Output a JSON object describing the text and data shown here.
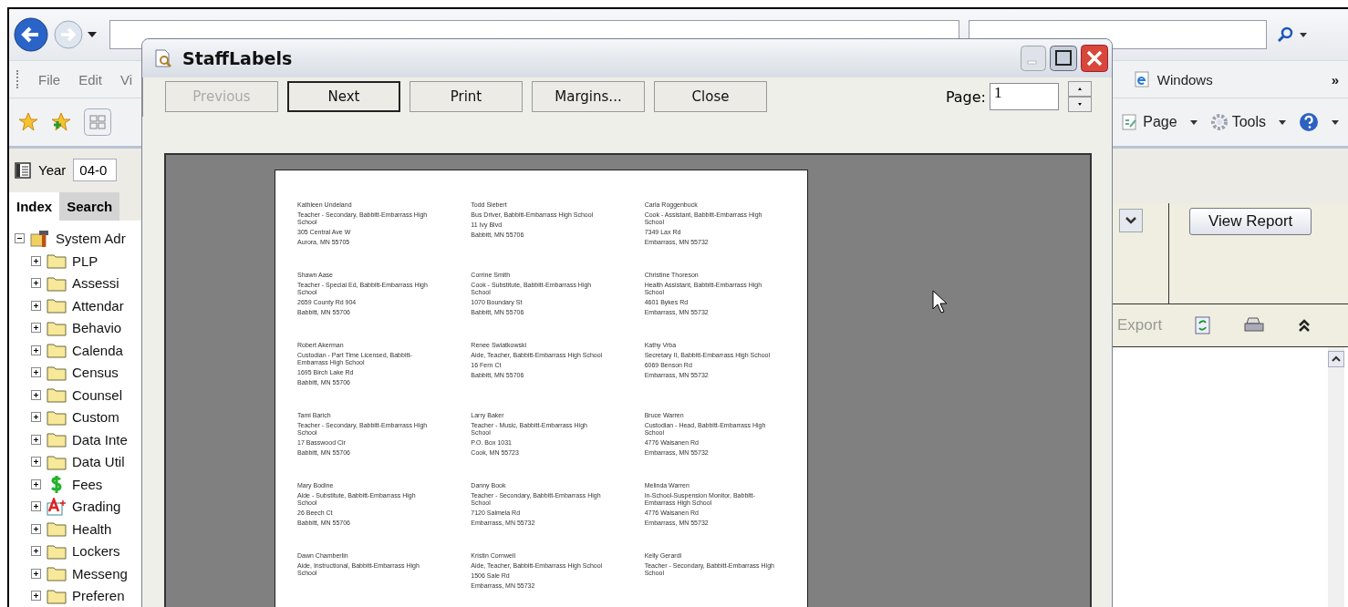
{
  "browser": {
    "menu": [
      "File",
      "Edit",
      "Vi"
    ],
    "links_bar": {
      "label": "Windows",
      "overflow": "»"
    },
    "command_bar": [
      {
        "label": "Page",
        "kind": "page"
      },
      {
        "label": "Tools",
        "kind": "tools"
      }
    ]
  },
  "left_panel": {
    "year_label": "Year",
    "year_value": "04-0",
    "tabs": [
      {
        "label": "Index",
        "selected": true
      },
      {
        "label": "Search",
        "selected": false
      }
    ],
    "tree": [
      {
        "label": "System Adr",
        "kind": "admin",
        "expanded": true,
        "children": [
          {
            "label": "PLP",
            "kind": "folder",
            "expanded": false
          },
          {
            "label": "Assessi",
            "kind": "folder",
            "expanded": false
          },
          {
            "label": "Attendar",
            "kind": "folder",
            "expanded": false
          },
          {
            "label": "Behavio",
            "kind": "folder",
            "expanded": false
          },
          {
            "label": "Calenda",
            "kind": "folder",
            "expanded": false
          },
          {
            "label": "Census",
            "kind": "folder",
            "expanded": false
          },
          {
            "label": "Counsel",
            "kind": "folder",
            "expanded": false
          },
          {
            "label": "Custom",
            "kind": "folder",
            "expanded": false
          },
          {
            "label": "Data Inte",
            "kind": "folder",
            "expanded": false
          },
          {
            "label": "Data Util",
            "kind": "folder",
            "expanded": false
          },
          {
            "label": "Fees",
            "kind": "fees",
            "expanded": false
          },
          {
            "label": "Grading",
            "kind": "grading",
            "expanded": false
          },
          {
            "label": "Health",
            "kind": "folder",
            "expanded": false
          },
          {
            "label": "Lockers",
            "kind": "folder",
            "expanded": false
          },
          {
            "label": "Messeng",
            "kind": "folder",
            "expanded": false
          },
          {
            "label": "Preferen",
            "kind": "folder",
            "expanded": false
          }
        ]
      }
    ]
  },
  "report_panel": {
    "view_report": "View Report",
    "export": "Export"
  },
  "dialog": {
    "title": "StaffLabels",
    "buttons": [
      {
        "label": "Previous",
        "disabled": true,
        "focused": false
      },
      {
        "label": "Next",
        "disabled": false,
        "focused": true
      },
      {
        "label": "Print",
        "disabled": false,
        "focused": false
      },
      {
        "label": "Margins...",
        "disabled": false,
        "focused": false
      },
      {
        "label": "Close",
        "disabled": false,
        "focused": false
      }
    ],
    "page_label": "Page:",
    "page_value": "1",
    "label_columns": [
      [
        {
          "lines": [
            "Kathleen Undeland",
            "Teacher - Secondary, Babbitt-Embarrass High School",
            "305 Central Ave W",
            "Aurora, MN 55705"
          ]
        },
        {
          "lines": [
            "Shawn Aase",
            "Teacher - Special Ed, Babbitt-Embarrass High School",
            "2659 County Rd 904",
            "Babbitt, MN 55706"
          ]
        },
        {
          "lines": [
            "Robert Akerman",
            "Custodian - Part Time Licensed, Babbitt-Embarrass High School",
            "1695 Birch Lake Rd",
            "Babbitt, MN 55706"
          ]
        },
        {
          "lines": [
            "Tami Barich",
            "Teacher - Secondary, Babbitt-Embarrass High School",
            "17 Basswood Cir",
            "Babbitt, MN 55706"
          ]
        },
        {
          "lines": [
            "Mary Bodine",
            "Aide - Substitute, Babbitt-Embarrass High School",
            "26 Beech Ct",
            "Babbitt, MN 55706"
          ]
        },
        {
          "lines": [
            "Dawn Chamberlin",
            "Aide, Instructional, Babbitt-Embarrass High School"
          ]
        }
      ],
      [
        {
          "lines": [
            "Todd Siebert",
            "Bus Driver, Babbitt-Embarrass High School",
            "11 Ivy Blvd",
            "Babbitt, MN 55706"
          ]
        },
        {
          "lines": [
            "Corrine Smith",
            "Cook - Substitute, Babbitt-Embarrass High School",
            "1070 Boundary St",
            "Babbitt, MN 55706"
          ]
        },
        {
          "lines": [
            "Renee Swiatkowski",
            "Aide, Teacher, Babbitt-Embarrass High School",
            "16 Fern Ct",
            "Babbitt, MN 55706"
          ]
        },
        {
          "lines": [
            "Larry Baker",
            "Teacher - Music, Babbitt-Embarrass High School",
            "P.O. Box 1031",
            "Cook, MN 55723"
          ]
        },
        {
          "lines": [
            "Danny Book",
            "Teacher - Secondary, Babbitt-Embarrass High School",
            "7120 Salmela Rd",
            "Embarrass, MN 55732"
          ]
        },
        {
          "lines": [
            "Kristin Cornwell",
            "Aide, Teacher, Babbitt-Embarrass High School",
            "1506 Sale Rd",
            "Embarrass, MN 55732"
          ]
        }
      ],
      [
        {
          "lines": [
            "Carla Roggenbuck",
            "Cook - Assistant, Babbitt-Embarrass High School",
            "7349 Lax Rd",
            "Embarrass, MN 55732"
          ]
        },
        {
          "lines": [
            "Christine Thoreson",
            "Health Assistant, Babbitt-Embarrass High School",
            "4601 Bykes Rd",
            "Embarrass, MN 55732"
          ]
        },
        {
          "lines": [
            "Kathy Vrba",
            "Secretary II, Babbitt-Embarrass High School",
            "6069 Benson Rd",
            "Embarrass, MN 55732"
          ]
        },
        {
          "lines": [
            "Bruce Warren",
            "Custodian - Head, Babbitt-Embarrass High School",
            "4776 Waisanen Rd",
            "Embarrass, MN 55732"
          ]
        },
        {
          "lines": [
            "Melinda Warren",
            "In-School-Suspension Monitor, Babbitt-Embarrass High School",
            "4776 Waisanen Rd",
            "Embarrass, MN 55732"
          ]
        },
        {
          "lines": [
            "Kelly Gerardi",
            "Teacher - Secondary, Babbitt-Embarrass High School"
          ]
        }
      ]
    ]
  }
}
